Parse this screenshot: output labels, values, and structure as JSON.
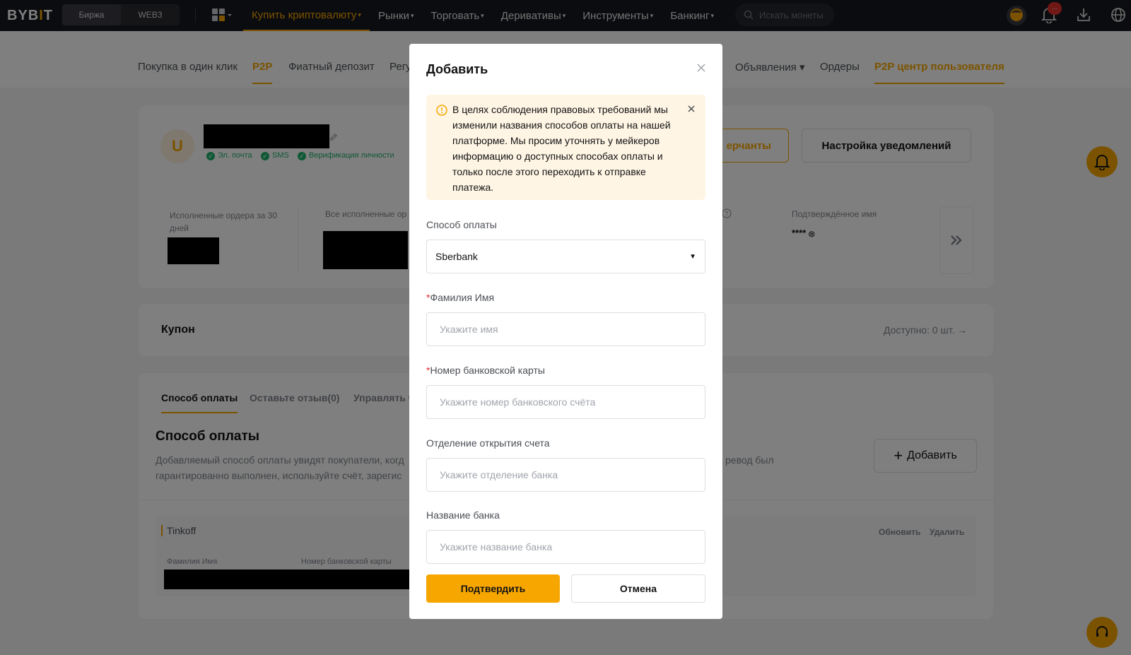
{
  "topnav": {
    "logo": "BYB",
    "logo_bar": "I",
    "logo_end": "T",
    "seg": [
      "Биржа",
      "WEB3"
    ],
    "items": [
      {
        "label": "Купить криптовалюту",
        "caret": true,
        "active": true
      },
      {
        "label": "Рынки",
        "caret": true
      },
      {
        "label": "Торговать",
        "caret": true
      },
      {
        "label": "Деривативы",
        "caret": true
      },
      {
        "label": "Инструменты",
        "caret": true
      },
      {
        "label": "Банкинг",
        "caret": true
      }
    ],
    "search_placeholder": "Искать монеты",
    "badge": "···"
  },
  "subnav": {
    "items": [
      "Покупка в один клик",
      "P2P",
      "Фиатный депозит",
      "Регу",
      "Объявления",
      "Ордеры",
      "P2P центр пользователя"
    ],
    "caret": "▾"
  },
  "profile": {
    "avatar_letter": "U",
    "verifs": [
      "Эл. почта",
      "SMS",
      "Верификация личности"
    ],
    "merchants_btn": "ерчанты",
    "notif_btn": "Настройка уведомлений"
  },
  "stats": {
    "orders30_label": "Исполненные ордера за 30 дней",
    "all_orders_label": "Все исполненные ор",
    "verified_name_label": "Подтверждённое имя",
    "verified_name_value": "****"
  },
  "coupon": {
    "label": "Купон",
    "available": "Доступно: 0 шт."
  },
  "payments": {
    "tabs": [
      "Способ оплаты",
      "Оставьте отзыв(0)",
      "Управлять ч"
    ],
    "title": "Способ оплаты",
    "desc_line1": "Добавляемый способ оплаты увидят покупатели, когд",
    "desc_line1b": "ревод был",
    "desc_line2": "гарантированно выполнен, используйте счёт, зарегис",
    "add_btn": "Добавить",
    "method_name": "Tinkoff",
    "update": "Обновить",
    "delete": "Удалить",
    "col1": "Фамилия Имя",
    "col2": "Номер банковской карты"
  },
  "modal": {
    "title": "Добавить",
    "notice": "В целях соблюдения правовых требований мы изменили названия способов оплаты на нашей платформе. Мы просим уточнять у мейкеров информацию о доступных способах оплаты и только после этого переходить к отправке платежа.",
    "pay_method_label": "Способ оплаты",
    "pay_method_value": "Sberbank",
    "name_label": "Фамилия Имя",
    "name_placeholder": "Укажите имя",
    "card_label": "Номер банковской карты",
    "card_placeholder": "Укажите номер банковского счёта",
    "branch_label": "Отделение открытия счета",
    "branch_placeholder": "Укажите отделение банка",
    "bank_label": "Название банка",
    "bank_placeholder": "Укажите название банка",
    "required_mark": "*",
    "confirm": "Подтвердить",
    "cancel": "Отмена"
  },
  "colors": {
    "accent": "#f7a600",
    "nav_bg": "#17181e",
    "success": "#20b26c",
    "notice_bg": "#fff5e4"
  }
}
